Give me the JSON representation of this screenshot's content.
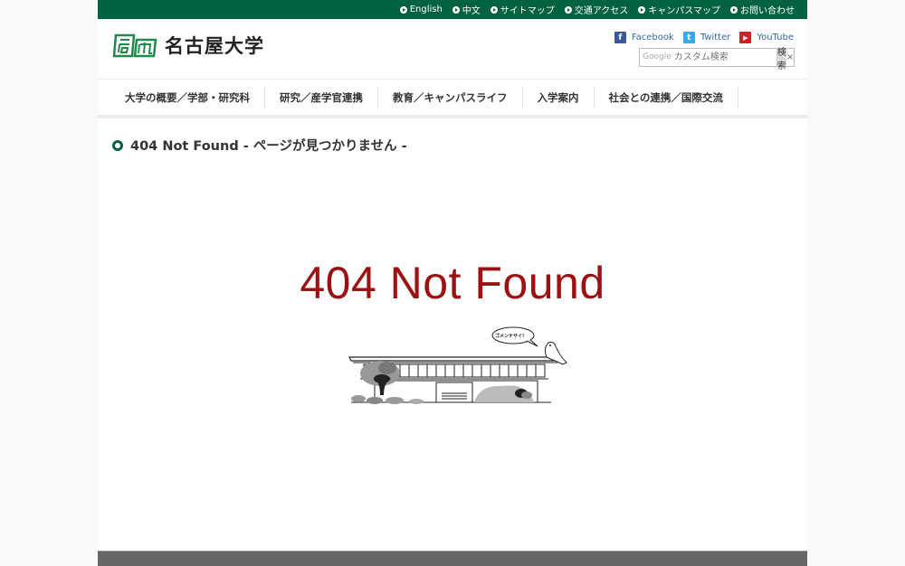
{
  "topbar": {
    "links": [
      {
        "label": "English"
      },
      {
        "label": "中文"
      },
      {
        "label": "サイトマップ"
      },
      {
        "label": "交通アクセス"
      },
      {
        "label": "キャンパスマップ"
      },
      {
        "label": "お問い合わせ"
      }
    ],
    "bg_color": "#006143"
  },
  "header": {
    "logo_text": "名古屋大学",
    "social": [
      {
        "label": "Facebook",
        "icon": "facebook-icon",
        "glyph": "f",
        "color": "#3b5998"
      },
      {
        "label": "Twitter",
        "icon": "twitter-icon",
        "glyph": "t",
        "color": "#33aaee"
      },
      {
        "label": "YouTube",
        "icon": "youtube-icon",
        "glyph": "▶",
        "color": "#cc2222"
      }
    ],
    "search": {
      "google_label": "Google",
      "placeholder": "カスタム検索",
      "button_label": "検索",
      "clear_label": "×"
    }
  },
  "nav": {
    "items": [
      {
        "label": "大学の概要／学部・研究科"
      },
      {
        "label": "研究／産学官連携"
      },
      {
        "label": "教育／キャンパスライフ"
      },
      {
        "label": "入学案内"
      },
      {
        "label": "社会との連携／国際交流"
      }
    ]
  },
  "main": {
    "heading": "404 Not Found - ページが見つかりません -",
    "big_title": "404 Not Found",
    "title_color": "#9b1212",
    "speech_bubble": "ゴメンナサイ!",
    "illustration": "university-building-with-bird"
  }
}
